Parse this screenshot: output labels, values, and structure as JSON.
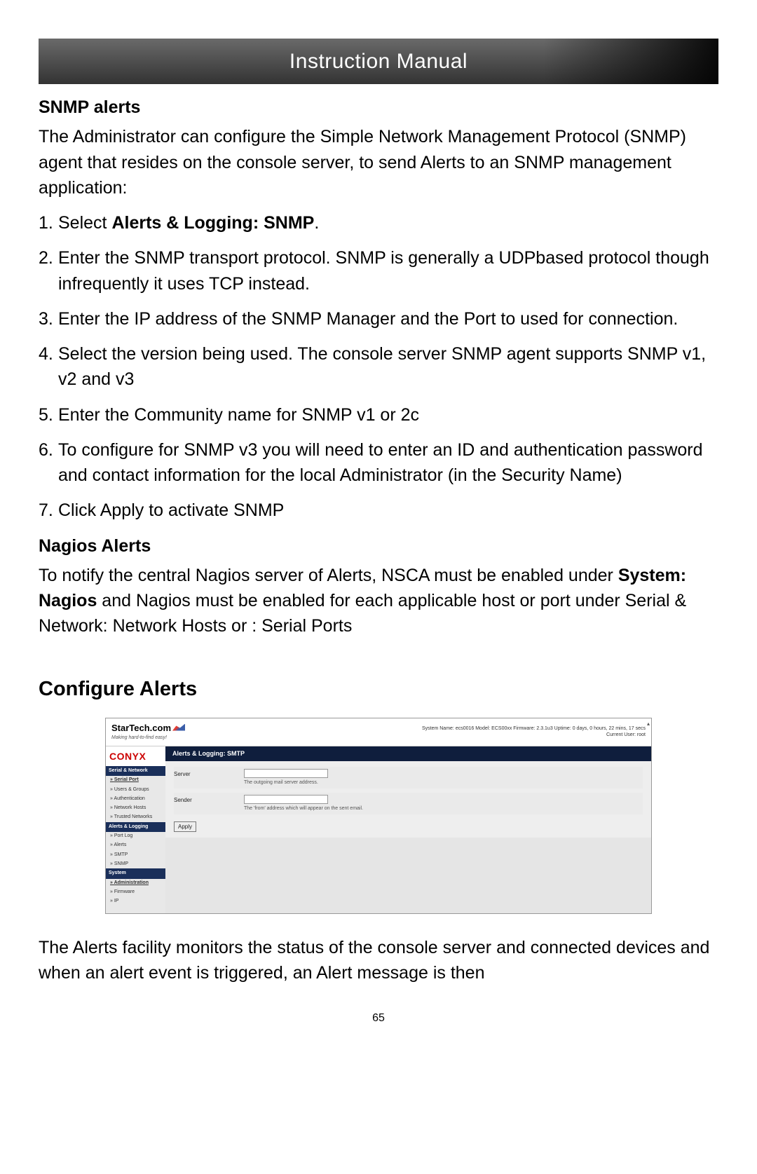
{
  "header": {
    "title": "Instruction Manual"
  },
  "snmp": {
    "heading": "SNMP alerts",
    "intro": "The Administrator can configure the Simple Network Management Protocol (SNMP) agent that resides on the console server, to send Alerts to an SNMP management application:",
    "steps": [
      {
        "num": "1.",
        "prefix": "Select ",
        "bold": "Alerts & Logging: SNMP",
        "suffix": "."
      },
      {
        "num": "2.",
        "text": "Enter the SNMP transport protocol. SNMP is generally a UDPbased protocol though infrequently it uses TCP instead."
      },
      {
        "num": "3.",
        "text": "Enter the IP address of the SNMP Manager and the Port to used for connection."
      },
      {
        "num": "4.",
        "text": "Select the version being used. The console server SNMP agent supports SNMP v1, v2 and v3"
      },
      {
        "num": "5.",
        "text": "Enter the Community name for SNMP v1 or 2c"
      },
      {
        "num": "6.",
        "text": "To configure for SNMP v3 you will need to enter an ID and authentication password and contact information for the local Administrator (in the Security Name)"
      },
      {
        "num": "7.",
        "text": "Click Apply to activate SNMP"
      }
    ]
  },
  "nagios": {
    "heading": "Nagios Alerts",
    "para_a": "To notify the central Nagios server of Alerts, NSCA must be enabled under ",
    "para_bold": "System: Nagios",
    "para_b": " and Nagios must be enabled for each applicable host or port under Serial & Network: Network Hosts or : Serial Ports"
  },
  "configure": {
    "heading": "Configure Alerts",
    "para": "The Alerts facility monitors the status of the console server and connected devices and when an alert event is triggered, an Alert message is then"
  },
  "screenshot": {
    "logo": "StarTech.com",
    "tagline": "Making hard-to-find easy!",
    "sys_line": "System Name: ecs0016   Model: ECS00xx   Firmware: 2.3.1u3   Uptime: 0 days, 0 hours, 22 mins, 17 secs",
    "user_line": "Current User: root",
    "conyx": "CONYX",
    "crumb": "Alerts & Logging: SMTP",
    "side": {
      "g1": "Serial & Network",
      "g1_items": [
        "Serial Port",
        "Users & Groups",
        "Authentication",
        "Network Hosts",
        "Trusted Networks"
      ],
      "g2": "Alerts & Logging",
      "g2_items": [
        "Port Log",
        "Alerts",
        "SMTP",
        "SNMP"
      ],
      "g3": "System",
      "g3_items": [
        "Administration",
        "Firmware",
        "IP"
      ]
    },
    "form": {
      "server_label": "Server",
      "server_help": "The outgoing mail server address.",
      "sender_label": "Sender",
      "sender_help": "The 'from' address which will appear on the sent email.",
      "apply": "Apply"
    }
  },
  "page": "65"
}
